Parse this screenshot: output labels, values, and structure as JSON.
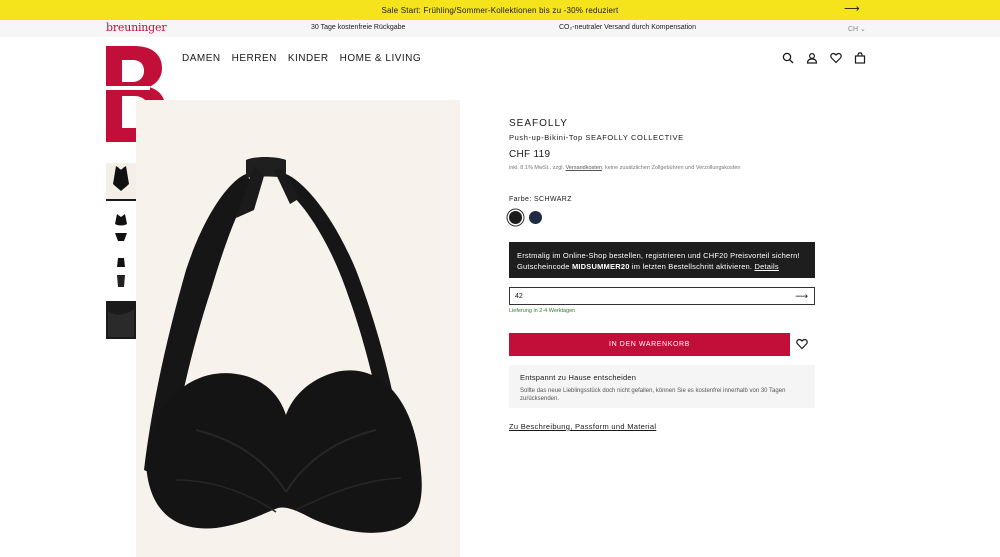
{
  "sale_banner": {
    "text": "Sale Start: Frühling/Sommer-Kollektionen bis zu -30% reduziert",
    "arrow": "⟶"
  },
  "utility_bar": {
    "logo": "breuninger",
    "usp_returns": "30 Tage kostenfreie Rückgabe",
    "usp_shipping": "CO₂-neutraler Versand durch Kompensation",
    "country": "CH ⌄"
  },
  "nav": {
    "items": [
      "DAMEN",
      "HERREN",
      "KINDER",
      "HOME & LIVING"
    ]
  },
  "header_icons": [
    "search-icon",
    "account-icon",
    "wishlist-icon",
    "bag-icon"
  ],
  "product": {
    "brand": "SEAFOLLY",
    "name": "Push-up-Bikini-Top SEAFOLLY COLLECTIVE",
    "price": "CHF 119",
    "price_note_prefix": "inkl. 8.1% MwSt., zzgl.",
    "price_note_link": "Versandkosten",
    "price_note_suffix": ", keine zusätzlichen Zollgebühren und Verzollungskosten",
    "color_label": "Farbe: SCHWARZ",
    "colors": [
      "#1b1b1b",
      "#1f2a44"
    ]
  },
  "promo": {
    "line1": "Erstmalig im Online-Shop bestellen, registrieren und CHF20 Preisvorteil sichern!",
    "line2_prefix": "Gutscheincode",
    "code": "MIDSUMMER20",
    "line2_suffix": "im letzten Bestellschritt aktivieren.",
    "link": "Details"
  },
  "size_select": {
    "value": "42",
    "arrow": "⟶"
  },
  "delivery": "Lieferung in 2-4 Werktagen",
  "cart_button": "IN DEN WARENKORB",
  "returns": {
    "title": "Entspannt zu Hause entscheiden",
    "text": "Sollte das neue Lieblingsstück doch nicht gefallen, können Sie es kostenfrei innerhalb von 30 Tagen zurücksenden."
  },
  "description_link": "Zu Beschreibung, Passform und Material",
  "colors": {
    "brand": "#c20f3a",
    "sale": "#f5e31c",
    "delivery": "#2f7a2f"
  }
}
